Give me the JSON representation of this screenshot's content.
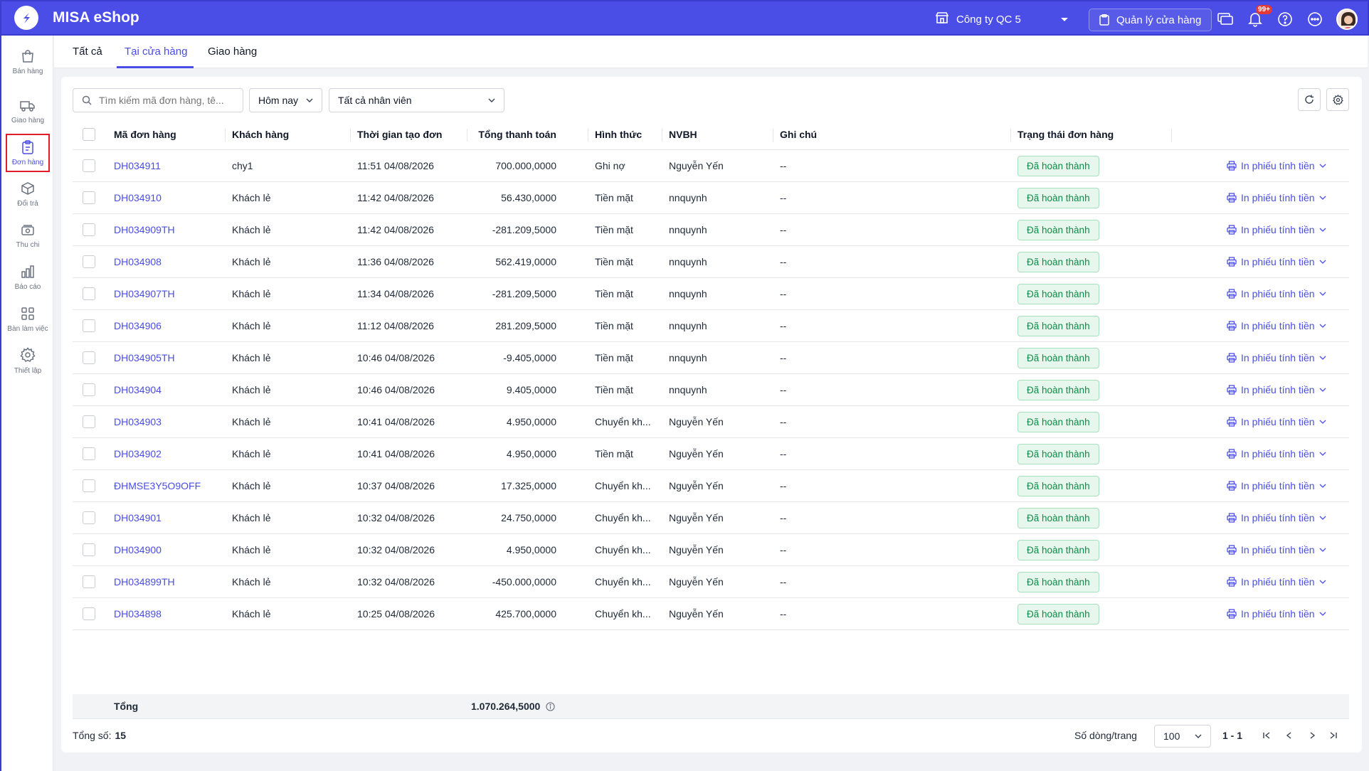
{
  "app": {
    "title": "MISA eShop"
  },
  "header": {
    "company": "Công ty QC 5",
    "manage_store": "Quản lý cửa hàng",
    "notif_badge": "99+"
  },
  "sidebar": {
    "items": [
      {
        "label": "Bán hàng",
        "icon": "shopping-bag-icon"
      },
      {
        "label": "Giao hàng",
        "icon": "truck-icon"
      },
      {
        "label": "Đơn hàng",
        "icon": "clipboard-icon",
        "active": true
      },
      {
        "label": "Đổi trả",
        "icon": "box-return-icon"
      },
      {
        "label": "Thu chi",
        "icon": "cash-icon"
      },
      {
        "label": "Báo cáo",
        "icon": "bar-chart-icon"
      },
      {
        "label": "Bàn làm việc",
        "icon": "grid-icon"
      },
      {
        "label": "Thiết lập",
        "icon": "gear-icon"
      }
    ]
  },
  "tabs": [
    {
      "label": "Tất cả"
    },
    {
      "label": "Tại cửa hàng",
      "active": true
    },
    {
      "label": "Giao hàng"
    }
  ],
  "filters": {
    "search_placeholder": "Tìm kiếm mã đơn hàng, tê...",
    "date": "Hôm nay",
    "staff": "Tất cả nhân viên"
  },
  "table": {
    "columns": [
      "Mã đơn hàng",
      "Khách hàng",
      "Thời gian tạo đơn",
      "Tổng thanh toán",
      "Hình thức",
      "NVBH",
      "Ghi chú",
      "Trạng thái đơn hàng"
    ],
    "action_label": "In phiếu tính tiền",
    "rows": [
      [
        "DH034911",
        "chy1",
        "11:51 04/08/2026",
        "700.000,0000",
        "Ghi nợ",
        "Nguyễn Yến",
        "--",
        "Đã hoàn thành"
      ],
      [
        "DH034910",
        "Khách lẻ",
        "11:42 04/08/2026",
        "56.430,0000",
        "Tiền mặt",
        "nnquynh",
        "--",
        "Đã hoàn thành"
      ],
      [
        "DH034909TH",
        "Khách lẻ",
        "11:42 04/08/2026",
        "-281.209,5000",
        "Tiền mặt",
        "nnquynh",
        "--",
        "Đã hoàn thành"
      ],
      [
        "DH034908",
        "Khách lẻ",
        "11:36 04/08/2026",
        "562.419,0000",
        "Tiền mặt",
        "nnquynh",
        "--",
        "Đã hoàn thành"
      ],
      [
        "DH034907TH",
        "Khách lẻ",
        "11:34 04/08/2026",
        "-281.209,5000",
        "Tiền mặt",
        "nnquynh",
        "--",
        "Đã hoàn thành"
      ],
      [
        "DH034906",
        "Khách lẻ",
        "11:12 04/08/2026",
        "281.209,5000",
        "Tiền mặt",
        "nnquynh",
        "--",
        "Đã hoàn thành"
      ],
      [
        "DH034905TH",
        "Khách lẻ",
        "10:46 04/08/2026",
        "-9.405,0000",
        "Tiền mặt",
        "nnquynh",
        "--",
        "Đã hoàn thành"
      ],
      [
        "DH034904",
        "Khách lẻ",
        "10:46 04/08/2026",
        "9.405,0000",
        "Tiền mặt",
        "nnquynh",
        "--",
        "Đã hoàn thành"
      ],
      [
        "DH034903",
        "Khách lẻ",
        "10:41 04/08/2026",
        "4.950,0000",
        "Chuyển kh...",
        "Nguyễn Yến",
        "--",
        "Đã hoàn thành"
      ],
      [
        "DH034902",
        "Khách lẻ",
        "10:41 04/08/2026",
        "4.950,0000",
        "Tiền mặt",
        "Nguyễn Yến",
        "--",
        "Đã hoàn thành"
      ],
      [
        "ĐHMSE3Y5O9OFF",
        "Khách lẻ",
        "10:37 04/08/2026",
        "17.325,0000",
        "Chuyển kh...",
        "Nguyễn Yến",
        "--",
        "Đã hoàn thành"
      ],
      [
        "DH034901",
        "Khách lẻ",
        "10:32 04/08/2026",
        "24.750,0000",
        "Chuyển kh...",
        "Nguyễn Yến",
        "--",
        "Đã hoàn thành"
      ],
      [
        "DH034900",
        "Khách lẻ",
        "10:32 04/08/2026",
        "4.950,0000",
        "Chuyển kh...",
        "Nguyễn Yến",
        "--",
        "Đã hoàn thành"
      ],
      [
        "DH034899TH",
        "Khách lẻ",
        "10:32 04/08/2026",
        "-450.000,0000",
        "Chuyển kh...",
        "Nguyễn Yến",
        "--",
        "Đã hoàn thành"
      ],
      [
        "DH034898",
        "Khách lẻ",
        "10:25 04/08/2026",
        "425.700,0000",
        "Chuyển kh...",
        "Nguyễn Yến",
        "--",
        "Đã hoàn thành"
      ]
    ]
  },
  "summary": {
    "label": "Tổng",
    "value": "1.070.264,5000"
  },
  "footer": {
    "total_label": "Tổng số:",
    "total_count": "15",
    "rows_per_page_label": "Số dòng/trang",
    "rows_per_page": "100",
    "range": "1 - 1"
  },
  "colors": {
    "brand": "#4a4de6",
    "status_bg": "#e8f7ee",
    "status_text": "#0f8a47"
  }
}
